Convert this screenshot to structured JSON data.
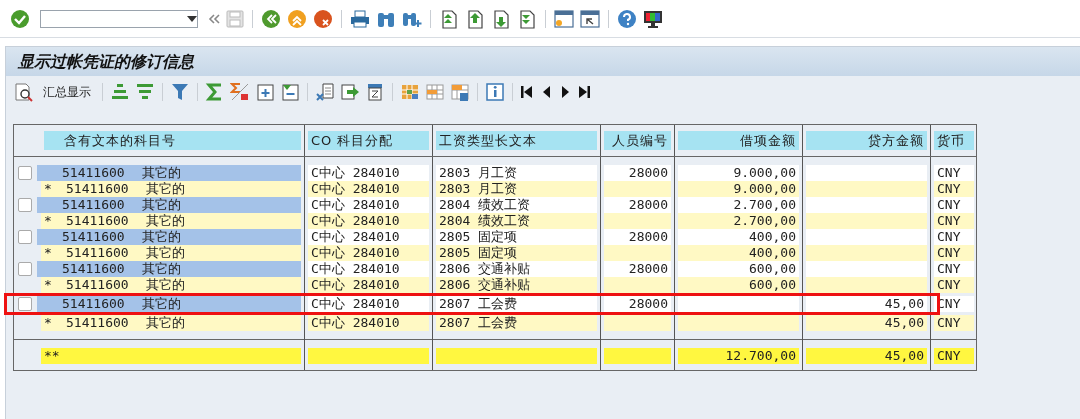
{
  "title": "显示过帐凭证的修订信息",
  "alv_toolbar": {
    "summary_button": "汇总显示"
  },
  "table": {
    "columns": [
      "含有文本的科目号",
      "CO 科目分配",
      "工资类型长文本",
      "人员编号",
      "借项金额",
      "贷方金额",
      "货币"
    ],
    "rows": [
      {
        "kind": "line",
        "checked": false,
        "highlighted": false,
        "account": "51411600",
        "account_text": "其它的",
        "co": "C中心 284010",
        "wage": "2803 月工资",
        "person": "28000",
        "debit": "9.000,00",
        "credit": "",
        "currency": "CNY"
      },
      {
        "kind": "subtotal",
        "marker": "*",
        "highlighted": false,
        "account": "51411600",
        "account_text": "其它的",
        "co": "C中心 284010",
        "wage": "2803 月工资",
        "person": "",
        "debit": "9.000,00",
        "credit": "",
        "currency": "CNY"
      },
      {
        "kind": "line",
        "checked": false,
        "highlighted": false,
        "account": "51411600",
        "account_text": "其它的",
        "co": "C中心 284010",
        "wage": "2804 绩效工资",
        "person": "28000",
        "debit": "2.700,00",
        "credit": "",
        "currency": "CNY"
      },
      {
        "kind": "subtotal",
        "marker": "*",
        "highlighted": false,
        "account": "51411600",
        "account_text": "其它的",
        "co": "C中心 284010",
        "wage": "2804 绩效工资",
        "person": "",
        "debit": "2.700,00",
        "credit": "",
        "currency": "CNY"
      },
      {
        "kind": "line",
        "checked": false,
        "highlighted": false,
        "account": "51411600",
        "account_text": "其它的",
        "co": "C中心 284010",
        "wage": "2805 固定项",
        "person": "28000",
        "debit": "400,00",
        "credit": "",
        "currency": "CNY"
      },
      {
        "kind": "subtotal",
        "marker": "*",
        "highlighted": false,
        "account": "51411600",
        "account_text": "其它的",
        "co": "C中心 284010",
        "wage": "2805 固定项",
        "person": "",
        "debit": "400,00",
        "credit": "",
        "currency": "CNY"
      },
      {
        "kind": "line",
        "checked": false,
        "highlighted": false,
        "account": "51411600",
        "account_text": "其它的",
        "co": "C中心 284010",
        "wage": "2806 交通补贴",
        "person": "28000",
        "debit": "600,00",
        "credit": "",
        "currency": "CNY"
      },
      {
        "kind": "subtotal",
        "marker": "*",
        "highlighted": false,
        "account": "51411600",
        "account_text": "其它的",
        "co": "C中心 284010",
        "wage": "2806 交通补贴",
        "person": "",
        "debit": "600,00",
        "credit": "",
        "currency": "CNY"
      },
      {
        "kind": "line",
        "checked": false,
        "highlighted": true,
        "account": "51411600",
        "account_text": "其它的",
        "co": "C中心 284010",
        "wage": "2807 工会费",
        "person": "28000",
        "debit": "",
        "credit": "45,00",
        "currency": "CNY"
      },
      {
        "kind": "subtotal",
        "marker": "*",
        "highlighted": false,
        "account": "51411600",
        "account_text": "其它的",
        "co": "C中心 284010",
        "wage": "2807 工会费",
        "person": "",
        "debit": "",
        "credit": "45,00",
        "currency": "CNY"
      }
    ],
    "total": {
      "marker": "**",
      "debit": "12.700,00",
      "credit": "45,00",
      "currency": "CNY"
    }
  }
}
